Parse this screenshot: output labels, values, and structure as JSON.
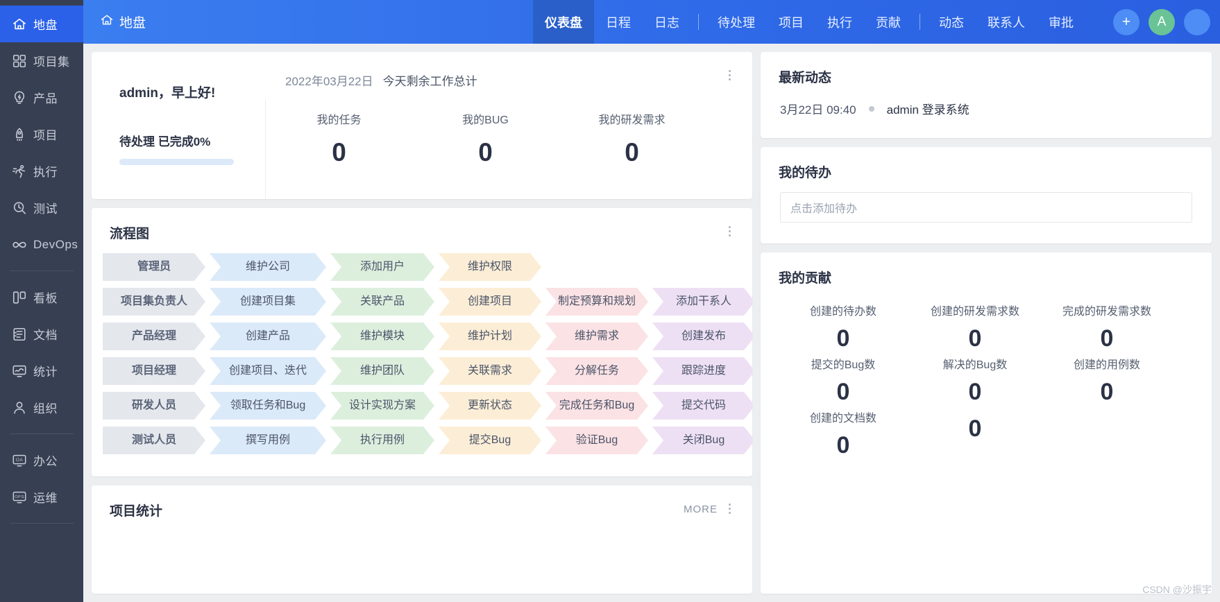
{
  "sidebar": {
    "items": [
      {
        "label": "地盘",
        "icon": "home-icon",
        "active": true
      },
      {
        "label": "项目集",
        "icon": "grid-icon",
        "active": false
      },
      {
        "label": "产品",
        "icon": "bulb-icon",
        "active": false
      },
      {
        "label": "项目",
        "icon": "rocket-icon",
        "active": false
      },
      {
        "label": "执行",
        "icon": "runner-icon",
        "active": false
      },
      {
        "label": "测试",
        "icon": "search-icon",
        "active": false
      },
      {
        "label": "DevOps",
        "icon": "infinity-icon",
        "active": false
      }
    ],
    "items2": [
      {
        "label": "看板",
        "icon": "kanban-icon"
      },
      {
        "label": "文档",
        "icon": "document-icon"
      },
      {
        "label": "统计",
        "icon": "chart-monitor-icon"
      },
      {
        "label": "组织",
        "icon": "user-icon"
      }
    ],
    "items3": [
      {
        "label": "办公",
        "icon": "oa-icon"
      },
      {
        "label": "运维",
        "icon": "ops-icon"
      }
    ]
  },
  "topbar": {
    "brand": "地盘",
    "brand_icon": "home-icon",
    "nav_group1": [
      {
        "label": "仪表盘",
        "active": true
      },
      {
        "label": "日程",
        "active": false
      },
      {
        "label": "日志",
        "active": false
      }
    ],
    "nav_group2": [
      {
        "label": "待处理",
        "active": false
      },
      {
        "label": "项目",
        "active": false
      },
      {
        "label": "执行",
        "active": false
      },
      {
        "label": "贡献",
        "active": false
      }
    ],
    "nav_group3": [
      {
        "label": "动态",
        "active": false
      },
      {
        "label": "联系人",
        "active": false
      },
      {
        "label": "审批",
        "active": false
      }
    ],
    "plus_label": "+",
    "avatar_label": "A"
  },
  "greeting": {
    "hello": "admin，早上好!",
    "progress_label": "待处理 已完成0%",
    "progress_pct": 0,
    "date": "2022年03月22日",
    "date_suffix": "今天剩余工作总计",
    "stats": [
      {
        "label": "我的任务",
        "value": "0"
      },
      {
        "label": "我的BUG",
        "value": "0"
      },
      {
        "label": "我的研发需求",
        "value": "0"
      }
    ]
  },
  "flowchart": {
    "title": "流程图",
    "rows": [
      {
        "cells": [
          "管理员",
          "维护公司",
          "添加用户",
          "维护权限",
          "",
          ""
        ]
      },
      {
        "cells": [
          "项目集负责人",
          "创建项目集",
          "关联产品",
          "创建项目",
          "制定预算和规划",
          "添加干系人"
        ]
      },
      {
        "cells": [
          "产品经理",
          "创建产品",
          "维护模块",
          "维护计划",
          "维护需求",
          "创建发布"
        ]
      },
      {
        "cells": [
          "项目经理",
          "创建项目、迭代",
          "维护团队",
          "关联需求",
          "分解任务",
          "跟踪进度"
        ]
      },
      {
        "cells": [
          "研发人员",
          "领取任务和Bug",
          "设计实现方案",
          "更新状态",
          "完成任务和Bug",
          "提交代码"
        ]
      },
      {
        "cells": [
          "测试人员",
          "撰写用例",
          "执行用例",
          "提交Bug",
          "验证Bug",
          "关闭Bug"
        ]
      }
    ],
    "colors": [
      "#e4e7ec",
      "#dbeaf9",
      "#dcefdd",
      "#fceed6",
      "#fbe2e4",
      "#eee0f4"
    ]
  },
  "project_stats": {
    "title": "项目统计",
    "more_label": "MORE"
  },
  "news": {
    "title": "最新动态",
    "items": [
      {
        "time": "3月22日 09:40",
        "text": "admin 登录系统"
      }
    ]
  },
  "todo": {
    "title": "我的待办",
    "placeholder": "点击添加待办"
  },
  "contribution": {
    "title": "我的贡献",
    "cells": [
      {
        "label": "创建的待办数",
        "value": "0"
      },
      {
        "label": "创建的研发需求数",
        "value": "0"
      },
      {
        "label": "完成的研发需求数",
        "value": "0"
      },
      {
        "label": "提交的Bug数",
        "value": "0"
      },
      {
        "label": "解决的Bug数",
        "value": "0"
      },
      {
        "label": "创建的用例数",
        "value": "0"
      },
      {
        "label": "创建的文档数",
        "value": "0"
      },
      {
        "label": "",
        "value": "0"
      },
      {
        "label": "",
        "value": ""
      }
    ]
  },
  "watermark": "CSDN @沙振宇"
}
